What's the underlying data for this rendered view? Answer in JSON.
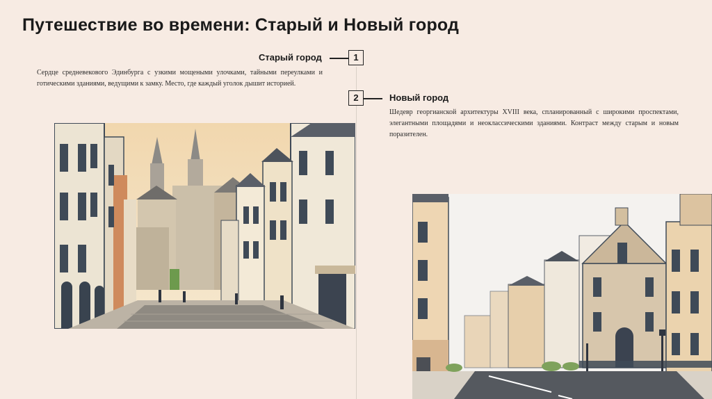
{
  "slide": {
    "title": "Путешествие во времени: Старый и Новый город"
  },
  "items": [
    {
      "number": "1",
      "heading": "Старый город",
      "text": "Сердце средневекового Эдинбурга с узкими мощеными улочками, тайными переулками и готическими зданиями, ведущими к замку. Место, где каждый уголок дышит историей."
    },
    {
      "number": "2",
      "heading": "Новый город",
      "text": "Шедевр георгианской архитектуры XVIII века, спланированный с широкими проспектами, элегантными площадями и неоклассическими зданиями. Контраст между старым и новым поразителен."
    }
  ],
  "colors": {
    "background": "#f7ebe3",
    "text": "#1a1a1a",
    "timeline": "#d9cfc6"
  }
}
